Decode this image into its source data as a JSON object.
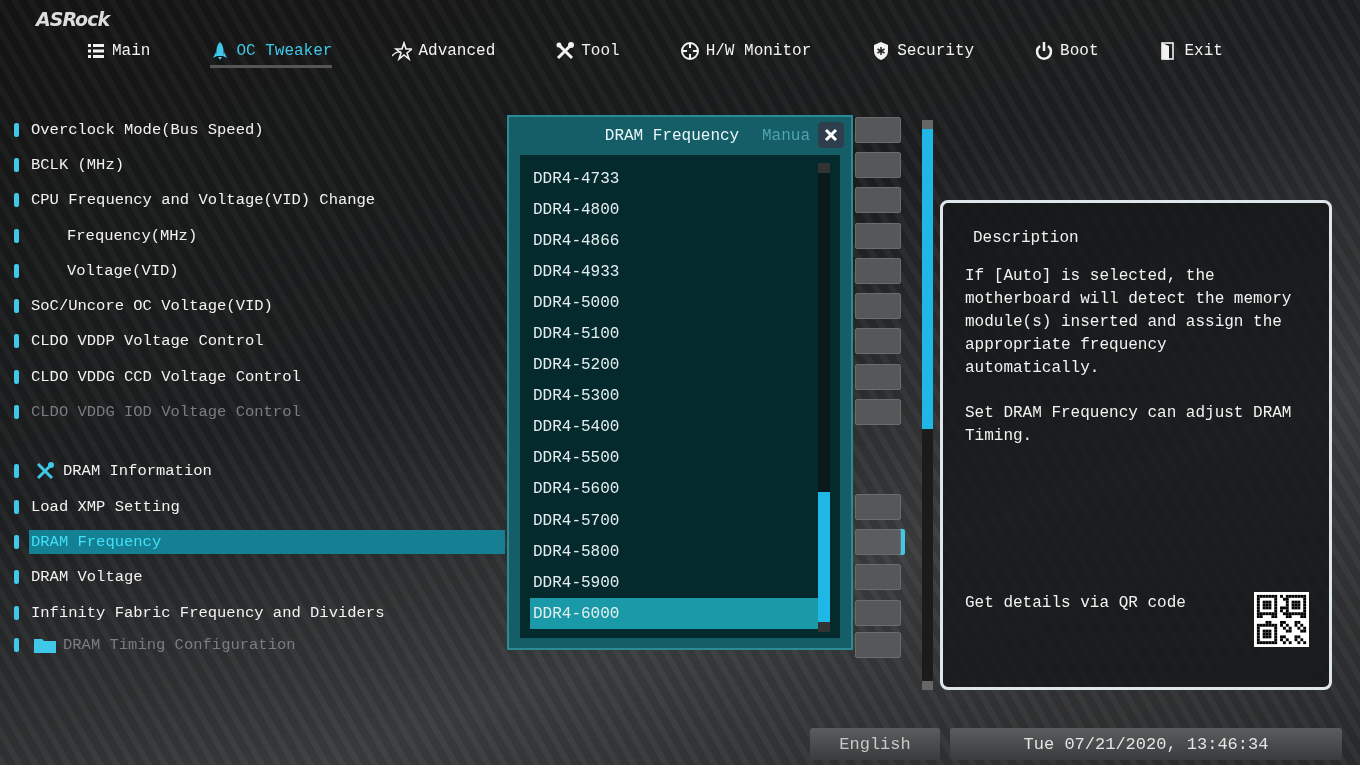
{
  "brand": "ASRock",
  "tabs": [
    {
      "label": "Main",
      "selected": false
    },
    {
      "label": "OC Tweaker",
      "selected": true
    },
    {
      "label": "Advanced",
      "selected": false
    },
    {
      "label": "Tool",
      "selected": false
    },
    {
      "label": "H/W Monitor",
      "selected": false
    },
    {
      "label": "Security",
      "selected": false
    },
    {
      "label": "Boot",
      "selected": false
    },
    {
      "label": "Exit",
      "selected": false
    }
  ],
  "settings": {
    "items": [
      {
        "label": "Overclock Mode(Bus Speed)",
        "kind": "item",
        "disabled": false,
        "selected": false,
        "value": "Manua"
      },
      {
        "label": "BCLK (MHz)",
        "kind": "item",
        "disabled": false,
        "selected": false
      },
      {
        "label": "CPU Frequency and Voltage(VID) Change",
        "kind": "item",
        "disabled": false,
        "selected": false
      },
      {
        "label": "Frequency(MHz)",
        "kind": "sub",
        "disabled": false,
        "selected": false
      },
      {
        "label": "Voltage(VID)",
        "kind": "sub",
        "disabled": false,
        "selected": false
      },
      {
        "label": "SoC/Uncore OC Voltage(VID)",
        "kind": "item",
        "disabled": false,
        "selected": false
      },
      {
        "label": "CLDO VDDP Voltage Control",
        "kind": "item",
        "disabled": false,
        "selected": false
      },
      {
        "label": "CLDO VDDG CCD Voltage Control",
        "kind": "item",
        "disabled": false,
        "selected": false
      },
      {
        "label": "CLDO VDDG IOD Voltage Control",
        "kind": "item",
        "disabled": true,
        "selected": false
      },
      {
        "label": "DRAM Information",
        "kind": "info",
        "disabled": false,
        "selected": false
      },
      {
        "label": "Load XMP Setting",
        "kind": "item",
        "disabled": false,
        "selected": false
      },
      {
        "label": "DRAM Frequency",
        "kind": "item",
        "disabled": false,
        "selected": true
      },
      {
        "label": "DRAM Voltage",
        "kind": "item",
        "disabled": false,
        "selected": false
      },
      {
        "label": "Infinity Fabric Frequency and Dividers",
        "kind": "item",
        "disabled": false,
        "selected": false
      },
      {
        "label": "DRAM Timing Configuration",
        "kind": "folder",
        "disabled": true,
        "selected": false
      }
    ]
  },
  "dialog": {
    "title": "DRAM Frequency",
    "options": [
      {
        "label": "DDR4-4733",
        "selected": false
      },
      {
        "label": "DDR4-4800",
        "selected": false
      },
      {
        "label": "DDR4-4866",
        "selected": false
      },
      {
        "label": "DDR4-4933",
        "selected": false
      },
      {
        "label": "DDR4-5000",
        "selected": false
      },
      {
        "label": "DDR4-5100",
        "selected": false
      },
      {
        "label": "DDR4-5200",
        "selected": false
      },
      {
        "label": "DDR4-5300",
        "selected": false
      },
      {
        "label": "DDR4-5400",
        "selected": false
      },
      {
        "label": "DDR4-5500",
        "selected": false
      },
      {
        "label": "DDR4-5600",
        "selected": false
      },
      {
        "label": "DDR4-5700",
        "selected": false
      },
      {
        "label": "DDR4-5800",
        "selected": false
      },
      {
        "label": "DDR4-5900",
        "selected": false
      },
      {
        "label": "DDR4-6000",
        "selected": true
      }
    ]
  },
  "description": {
    "title": "Description",
    "paragraphs": [
      "If [Auto] is selected, the motherboard will detect the memory module(s) inserted and assign the appropriate frequency automatically.",
      "Set DRAM Frequency can adjust DRAM Timing."
    ],
    "qr_caption": "Get details via QR code"
  },
  "status_bar": {
    "language": "English",
    "datetime": "Tue 07/21/2020, 13:46:34"
  }
}
